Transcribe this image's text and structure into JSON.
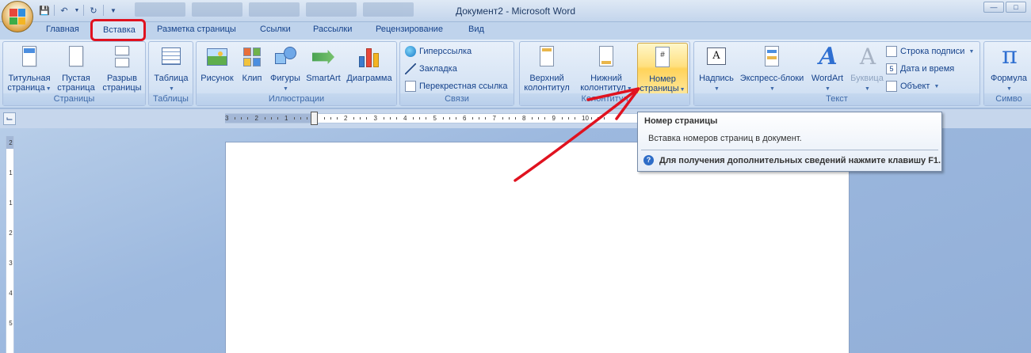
{
  "window": {
    "title": "Документ2 - Microsoft Word"
  },
  "tabs": [
    {
      "label": "Главная"
    },
    {
      "label": "Вставка"
    },
    {
      "label": "Разметка страницы"
    },
    {
      "label": "Ссылки"
    },
    {
      "label": "Рассылки"
    },
    {
      "label": "Рецензирование"
    },
    {
      "label": "Вид"
    }
  ],
  "active_tab": "Вставка",
  "groups": {
    "pages": {
      "label": "Страницы",
      "cover": [
        "Титульная",
        "страница"
      ],
      "blank": [
        "Пустая",
        "страница"
      ],
      "break": [
        "Разрыв",
        "страницы"
      ]
    },
    "tables": {
      "label": "Таблицы",
      "table": "Таблица"
    },
    "illustrations": {
      "label": "Иллюстрации",
      "picture": "Рисунок",
      "clip": "Клип",
      "shapes": "Фигуры",
      "smartart": "SmartArt",
      "chart": "Диаграмма"
    },
    "links": {
      "label": "Связи",
      "hyperlink": "Гиперссылка",
      "bookmark": "Закладка",
      "crossref": "Перекрестная ссылка"
    },
    "header_footer": {
      "label": "Колонтитулы",
      "label_visible": "Колонтитул",
      "header": [
        "Верхний",
        "колонтитул"
      ],
      "footer": [
        "Нижний",
        "колонтитул"
      ],
      "page_number": [
        "Номер",
        "страницы"
      ]
    },
    "text": {
      "label": "Текст",
      "textbox": "Надпись",
      "quickparts": "Экспресс-блоки",
      "wordart": "WordArt",
      "dropcap": "Буквица",
      "signature": "Строка подписи",
      "datetime": "Дата и время",
      "object": "Объект"
    },
    "symbols": {
      "label": "Симво",
      "equation": "Формула"
    }
  },
  "ruler": {
    "numbers": [
      "3",
      "2",
      "1",
      "1",
      "2",
      "3",
      "4",
      "5",
      "6",
      "7",
      "8",
      "9",
      "10"
    ],
    "vertical_numbers": [
      "2",
      "1",
      "1",
      "2",
      "3",
      "4",
      "5"
    ]
  },
  "tooltip": {
    "title": "Номер страницы",
    "body": "Вставка номеров страниц в документ.",
    "help": "Для получения дополнительных сведений нажмите клавишу F1."
  },
  "colors": {
    "annotation_red": "#e0121f",
    "highlight": "#ffd35a",
    "ribbon_text": "#15428b"
  }
}
